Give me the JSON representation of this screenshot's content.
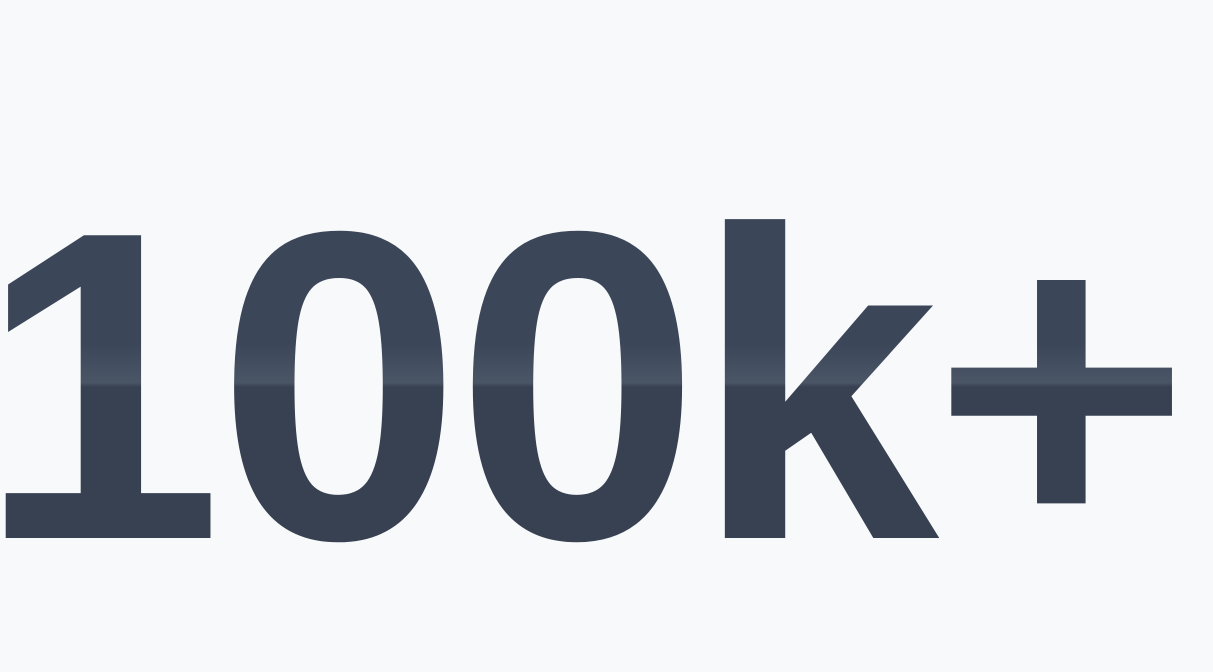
{
  "stat": {
    "value": "100k+",
    "color": "#374151"
  },
  "background_color": "#f8f9fa"
}
